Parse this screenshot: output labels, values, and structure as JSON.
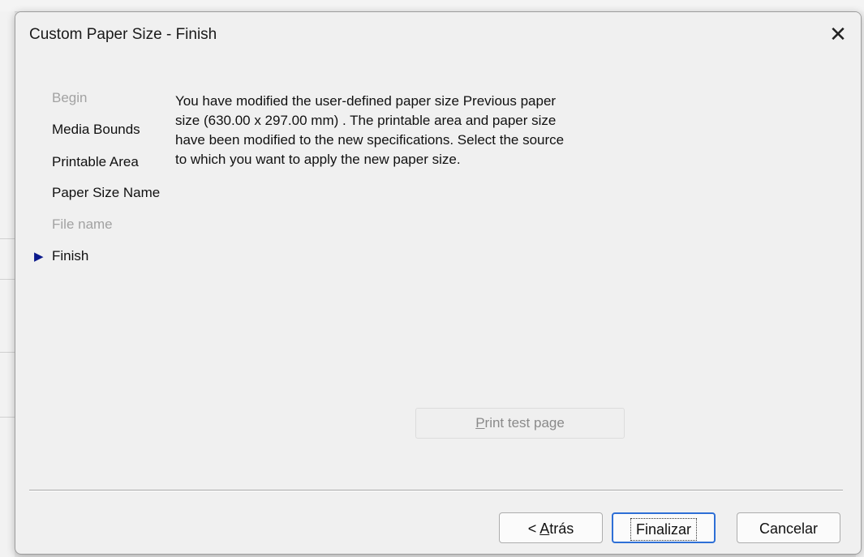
{
  "dialog": {
    "title": "Custom Paper Size - Finish",
    "close_glyph": "✕"
  },
  "steps": [
    {
      "label": "Begin",
      "state": "disabled"
    },
    {
      "label": "Media Bounds",
      "state": "normal"
    },
    {
      "label": "Printable Area",
      "state": "normal"
    },
    {
      "label": "Paper Size Name",
      "state": "normal"
    },
    {
      "label": "File name",
      "state": "disabled"
    },
    {
      "label": "Finish",
      "state": "current"
    }
  ],
  "current_step_icon": "right-triangle-icon",
  "message": {
    "line1": "You have modified the user-defined paper size Previous paper",
    "line2": "size  (630.00 x 297.00 mm) . The printable area and paper size",
    "line3": "have been modified to the new specifications. Select the source",
    "line4": "to which you want to apply the new paper size."
  },
  "print_test": {
    "accel": "P",
    "rest": "rint test page"
  },
  "buttons": {
    "back_prefix": "< ",
    "back_accel": "A",
    "back_rest": "trás",
    "finish": "Finalizar",
    "cancel": "Cancelar"
  },
  "colors": {
    "arrow": "#0b1a8c",
    "default_button_border": "#2e6fd6",
    "disabled_text": "#a2a2a2"
  }
}
